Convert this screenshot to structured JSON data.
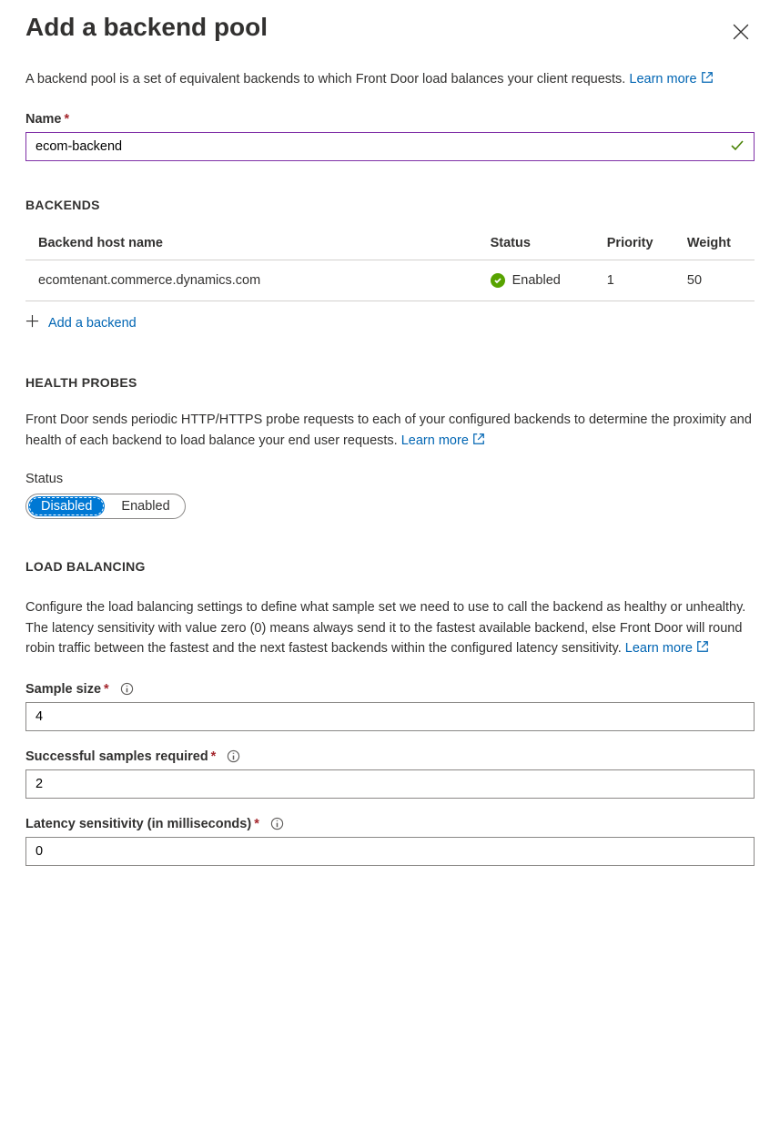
{
  "header": {
    "title": "Add a backend pool"
  },
  "description": {
    "text": "A backend pool is a set of equivalent backends to which Front Door load balances your client requests. ",
    "learn_more": "Learn more"
  },
  "name_field": {
    "label": "Name",
    "value": "ecom-backend"
  },
  "backends": {
    "section_title": "BACKENDS",
    "columns": {
      "host": "Backend host name",
      "status": "Status",
      "priority": "Priority",
      "weight": "Weight"
    },
    "rows": [
      {
        "host": "ecomtenant.commerce.dynamics.com",
        "status": "Enabled",
        "priority": "1",
        "weight": "50"
      }
    ],
    "add_label": "Add a backend"
  },
  "health_probes": {
    "section_title": "HEALTH PROBES",
    "description": "Front Door sends periodic HTTP/HTTPS probe requests to each of your configured backends to determine the proximity and health of each backend to load balance your end user requests. ",
    "learn_more": "Learn more",
    "status_label": "Status",
    "toggle": {
      "disabled": "Disabled",
      "enabled": "Enabled"
    }
  },
  "load_balancing": {
    "section_title": "LOAD BALANCING",
    "description": "Configure the load balancing settings to define what sample set we need to use to call the backend as healthy or unhealthy. The latency sensitivity with value zero (0) means always send it to the fastest available backend, else Front Door will round robin traffic between the fastest and the next fastest backends within the configured latency sensitivity. ",
    "learn_more": "Learn more",
    "sample_size": {
      "label": "Sample size",
      "value": "4"
    },
    "successful": {
      "label": "Successful samples required",
      "value": "2"
    },
    "latency": {
      "label": "Latency sensitivity (in milliseconds)",
      "value": "0"
    }
  }
}
